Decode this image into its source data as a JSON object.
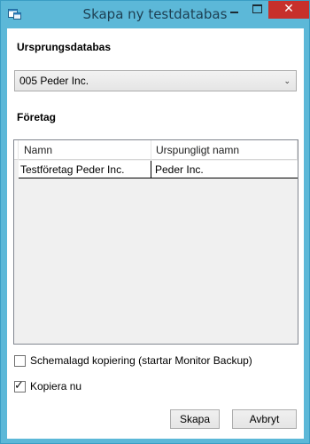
{
  "window": {
    "title": "Skapa ny testdatabas"
  },
  "source": {
    "label": "Ursprungsdatabas",
    "selected": "005 Peder Inc."
  },
  "companies": {
    "label": "Företag",
    "columns": [
      "Namn",
      "Urspungligt namn"
    ],
    "rows": [
      {
        "name": "Testföretag Peder Inc.",
        "original_name": "Peder Inc."
      }
    ]
  },
  "options": {
    "scheduled_copy": {
      "label": "Schemalagd kopiering (startar Monitor Backup)",
      "checked": false
    },
    "copy_now": {
      "label": "Kopiera nu",
      "checked": true
    }
  },
  "buttons": {
    "create": "Skapa",
    "cancel": "Avbryt"
  },
  "colors": {
    "titlebar": "#5cb8d8",
    "close": "#c7302b"
  }
}
